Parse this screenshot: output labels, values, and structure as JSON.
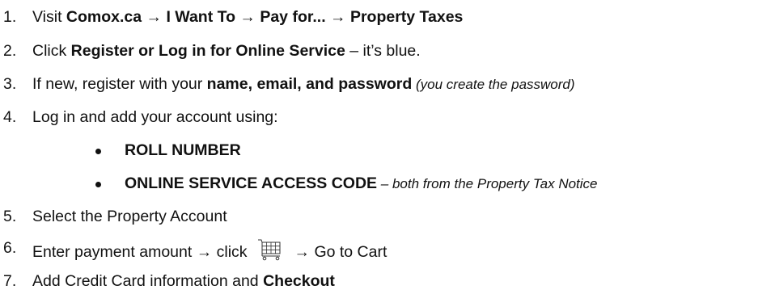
{
  "steps": [
    {
      "num": "1.",
      "t1": "Visit ",
      "b1": "Comox.ca → I Want To → Pay for... → Property Taxes"
    },
    {
      "num": "2.",
      "t1": "Click ",
      "b1": "Register or Log in for Online Service",
      "t2": " – it’s blue."
    },
    {
      "num": "3.",
      "t1": "If new, register with your ",
      "b1": "name, email, and password",
      "i1": " (you create the password)"
    },
    {
      "num": "4.",
      "t1": "Log in and add your account using:"
    },
    {
      "num": "5.",
      "t1": "Select the Property Account"
    },
    {
      "num": "6.",
      "t1": "Enter payment amount → click",
      "t2": "→ Go to Cart"
    },
    {
      "num": "7.",
      "t1": "Add Credit Card information and ",
      "b1": "Checkout"
    }
  ],
  "bullets": [
    {
      "b1": "ROLL NUMBER"
    },
    {
      "b1": "ONLINE SERVICE ACCESS CODE",
      "i1": " – both from the Property Tax Notice"
    }
  ],
  "icons": {
    "cart": "shopping-cart-icon"
  }
}
